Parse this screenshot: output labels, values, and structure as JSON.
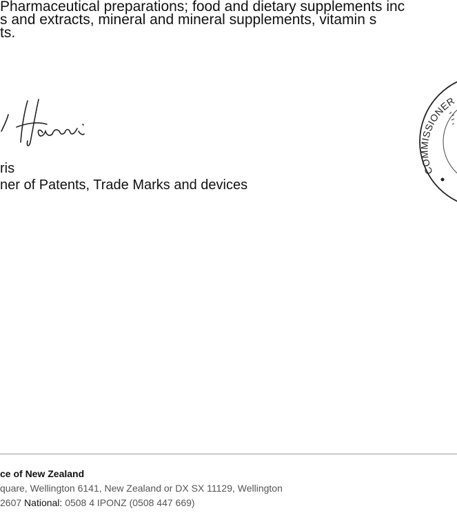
{
  "goods": {
    "line1": "Pharmaceutical preparations; food and dietary supplements inc",
    "line2": "s and extracts, mineral and mineral supplements, vitamin s",
    "line3": "ts."
  },
  "signatory": {
    "name": "ris",
    "title": "ner of Patents, Trade Marks and devices"
  },
  "seal": {
    "text": "COMMISSIONER OF"
  },
  "footer": {
    "org": "ce of New Zealand",
    "address": "quare, Wellington 6141, New Zealand or DX SX 11129, Wellington",
    "phone_prefix": "2607",
    "national_label": "National:",
    "national_value": "0508 4 IPONZ (0508 447 669)"
  }
}
